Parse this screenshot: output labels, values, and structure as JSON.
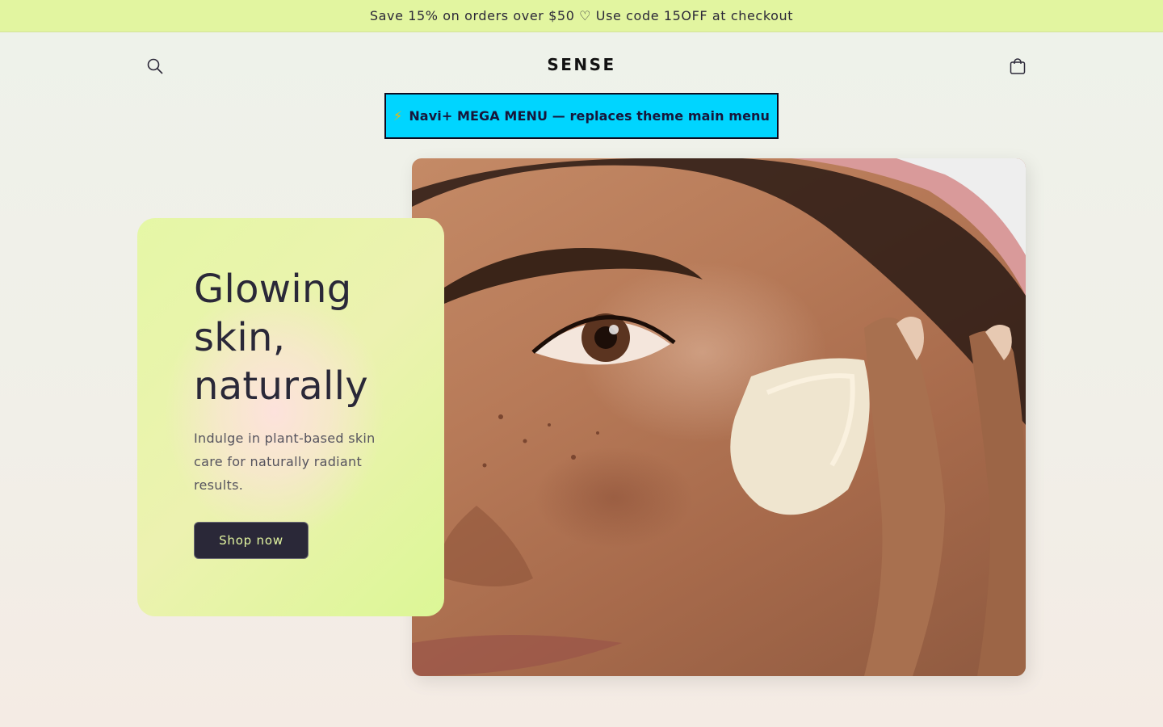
{
  "announcement": {
    "text": "Save 15% on orders over $50 ♡ Use code 15OFF at checkout"
  },
  "header": {
    "logo": "SENSE",
    "search_icon": "search-icon",
    "cart_icon": "cart-icon"
  },
  "mega_menu": {
    "bolt": "⚡",
    "label": "Navi+ MEGA MENU — replaces theme main menu"
  },
  "hero": {
    "title": "Glowing skin, naturally",
    "subtitle": "Indulge in plant-based skin care for naturally radiant results.",
    "button_label": "Shop now"
  },
  "colors": {
    "announcement_bg": "#e2f5a0",
    "mega_menu_bg": "#00d5ff",
    "button_bg": "#2a2838",
    "button_text": "#e2f5a0"
  }
}
